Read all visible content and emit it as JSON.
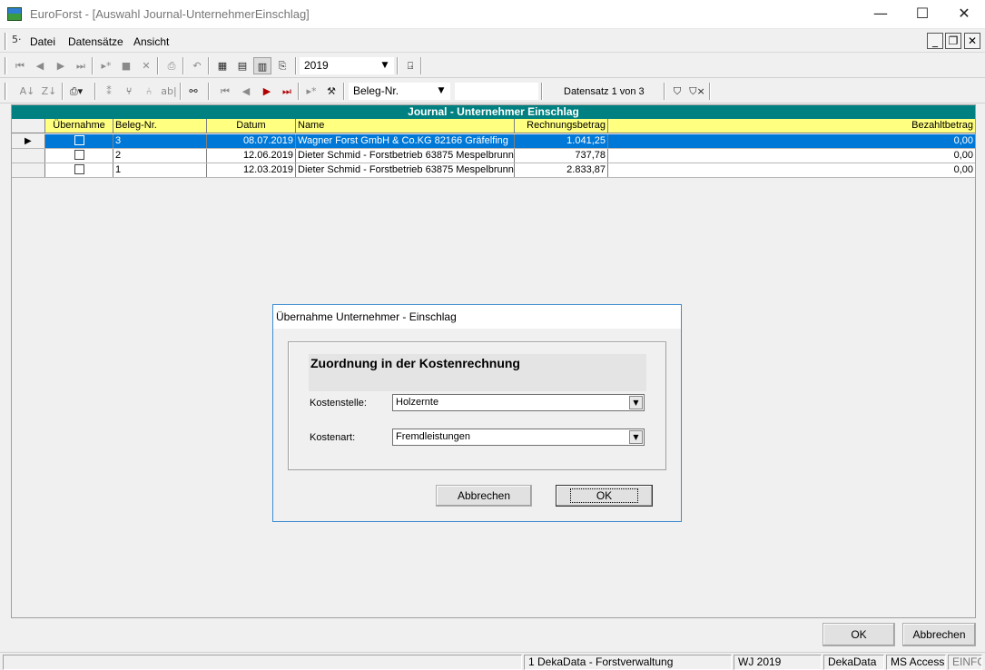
{
  "window": {
    "title": "EuroForst - [Auswahl Journal-UnternehmerEinschlag]",
    "minimize": "—",
    "maximize": "☐",
    "close": "✕"
  },
  "menu": {
    "items": [
      "Datei",
      "Datensätze",
      "Ansicht"
    ],
    "mdi_min": "_",
    "mdi_restore": "❐",
    "mdi_close": "✕"
  },
  "toolbar1": {
    "year": "2019"
  },
  "toolbar2": {
    "sort_field": "Beleg-Nr.",
    "record_info": "Datensatz 1 von 3"
  },
  "grid": {
    "title": "Journal - Unternehmer Einschlag",
    "columns": [
      "Übernahme",
      "Beleg-Nr.",
      "Datum",
      "Name",
      "Rechnungsbetrag",
      "Bezahltbetrag"
    ],
    "rows": [
      {
        "beleg": "3",
        "datum": "08.07.2019",
        "name": "Wagner Forst GmbH & Co.KG  82166 Gräfelfing",
        "rechnung": "1.041,25",
        "bezahlt": "0,00"
      },
      {
        "beleg": "2",
        "datum": "12.06.2019",
        "name": "Dieter Schmid - Forstbetrieb  63875 Mespelbrunn",
        "rechnung": "737,78",
        "bezahlt": "0,00"
      },
      {
        "beleg": "1",
        "datum": "12.03.2019",
        "name": "Dieter Schmid - Forstbetrieb  63875 Mespelbrunn",
        "rechnung": "2.833,87",
        "bezahlt": "0,00"
      }
    ]
  },
  "dialog": {
    "title": "Übernahme Unternehmer - Einschlag",
    "heading": "Zuordnung in der Kostenrechnung",
    "kostenstelle_label": "Kostenstelle:",
    "kostenstelle_value": "Holzernte",
    "kostenart_label": "Kostenart:",
    "kostenart_value": "Fremdleistungen",
    "cancel": "Abbrechen",
    "ok": "OK"
  },
  "footer": {
    "ok": "OK",
    "cancel": "Abbrechen"
  },
  "status": {
    "company": "1 DekaData - Forstverwaltung",
    "year": "WJ 2019",
    "vendor": "DekaData",
    "db": "MS Access",
    "mode": "EINFG"
  }
}
